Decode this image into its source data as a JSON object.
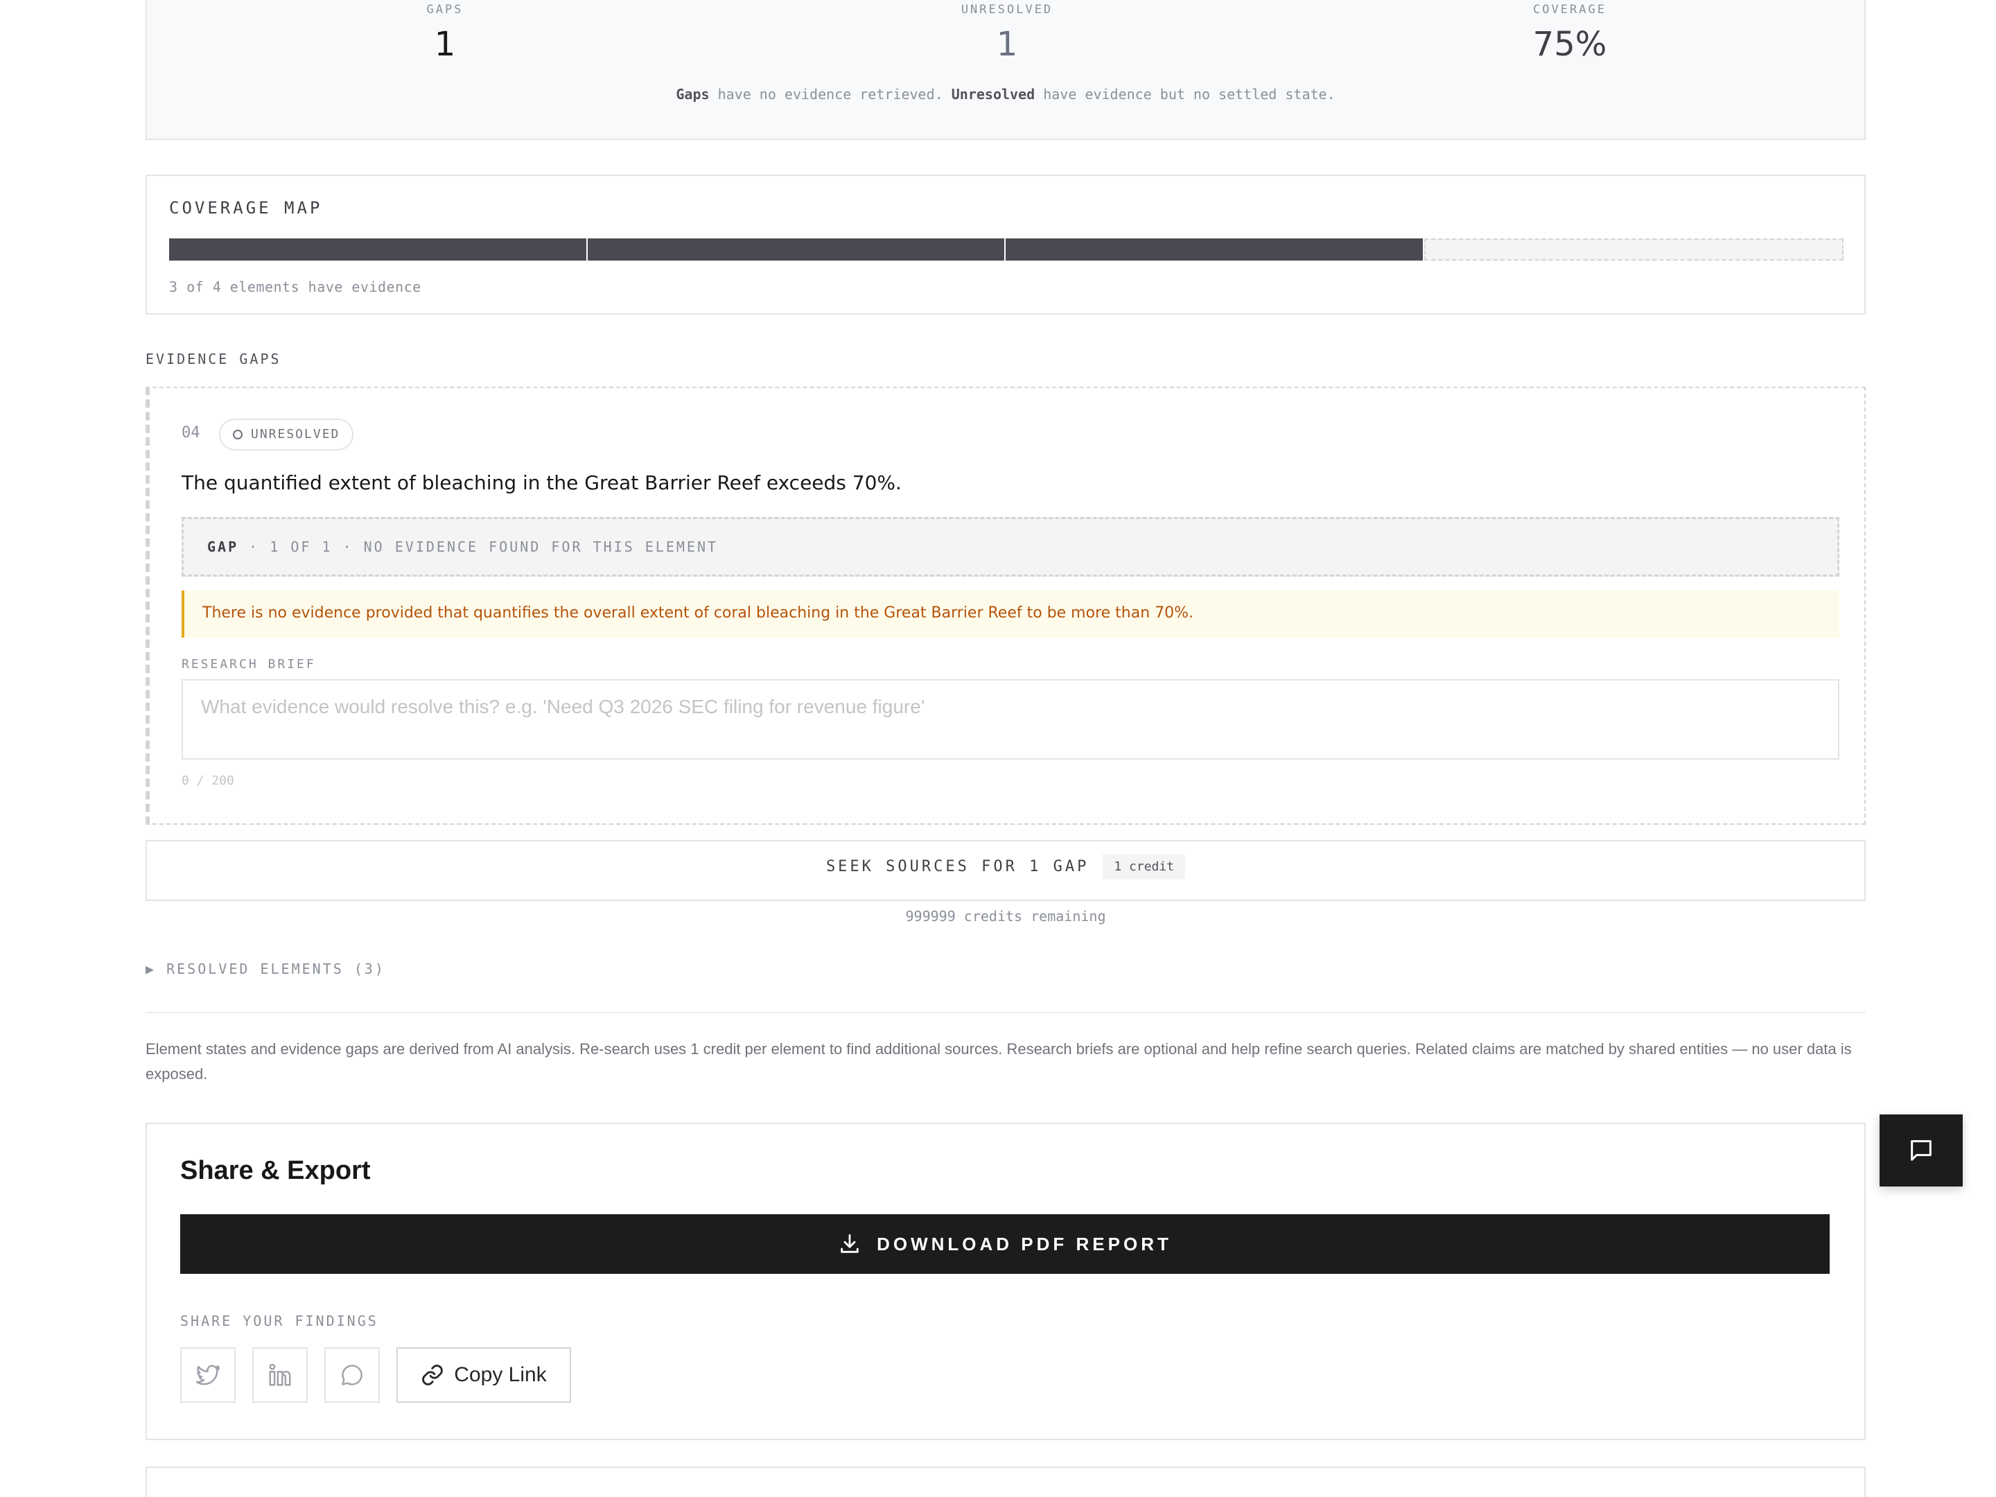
{
  "stats": {
    "gaps": {
      "label": "GAPS",
      "value": "1"
    },
    "unresolved": {
      "label": "UNRESOLVED",
      "value": "1"
    },
    "coverage": {
      "label": "COVERAGE",
      "value": "75%"
    },
    "note": {
      "gaps_word": "Gaps",
      "gaps_text": " have no evidence retrieved. ",
      "unresolved_word": "Unresolved",
      "unresolved_text": " have evidence but no settled state."
    }
  },
  "coverage_map": {
    "title": "COVERAGE MAP",
    "segments": [
      true,
      true,
      true,
      false
    ],
    "note": "3 of 4 elements have evidence"
  },
  "evidence_gaps": {
    "title": "EVIDENCE GAPS",
    "element": {
      "number": "04",
      "status": "UNRESOLVED",
      "claim": "The quantified extent of bleaching in the Great Barrier Reef exceeds 70%.",
      "gap_prefix": "GAP",
      "gap_index": " · 1 OF 1 · ",
      "gap_text": "NO EVIDENCE FOUND FOR THIS ELEMENT",
      "warning": "There is no evidence provided that quantifies the overall extent of coral bleaching in the Great Barrier Reef to be more than 70%.",
      "research_brief_label": "RESEARCH BRIEF",
      "research_brief_placeholder": "What evidence would resolve this? e.g. 'Need Q3 2026 SEC filing for revenue figure'",
      "research_brief_value": "",
      "char_count": "0 / 200"
    }
  },
  "seek": {
    "label": "SEEK SOURCES FOR 1 GAP",
    "cost": "1 credit",
    "remaining": "999999 credits remaining"
  },
  "resolved": {
    "label": "▶ RESOLVED ELEMENTS (3)"
  },
  "disclaimer": "Element states and evidence gaps are derived from AI analysis. Re-search uses 1 credit per element to find additional sources. Research briefs are optional and help refine search queries. Related claims are matched by shared entities — no user data is exposed.",
  "share": {
    "title": "Share & Export",
    "download_label": "DOWNLOAD PDF REPORT",
    "share_label": "SHARE YOUR FINDINGS",
    "copy_label": "Copy Link",
    "icons": [
      "twitter-icon",
      "linkedin-icon",
      "chat-icon",
      "link-icon",
      "download-icon"
    ]
  },
  "colors": {
    "filled_segment": "#4a4a52",
    "warning_text": "#b45309",
    "warning_border": "#e6a817",
    "primary_button": "#1c1c1f"
  }
}
